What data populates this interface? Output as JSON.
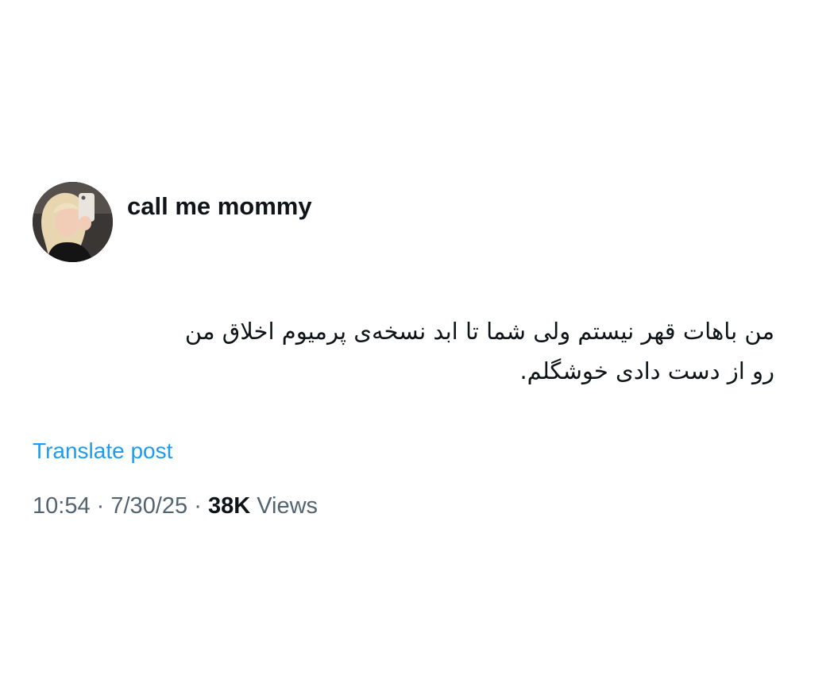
{
  "author": {
    "display_name": "call me mommy",
    "avatar_icon": "profile-photo-selfie"
  },
  "tweet": {
    "text_line_1": "من باهات قهر نیستم ولی شما تا ابد نسخه‌ی پرمیوم اخلاق من",
    "text_line_2": "رو از دست دادی خوشگلم."
  },
  "translate_label": "Translate post",
  "meta": {
    "time": "10:54",
    "date": "7/30/25",
    "separator": "·",
    "views_count": "38K",
    "views_label": "Views"
  },
  "colors": {
    "link": "#1d9bf0",
    "secondary_text": "#536471",
    "primary_text": "#0f1419"
  }
}
